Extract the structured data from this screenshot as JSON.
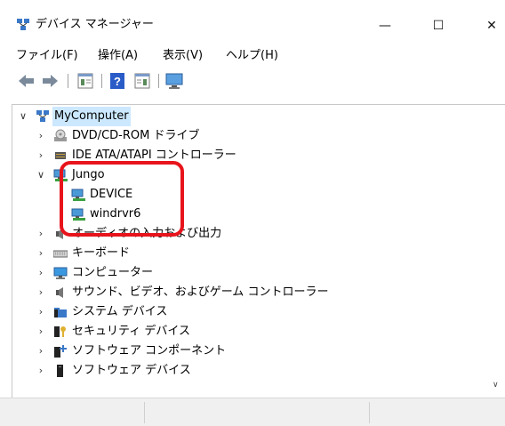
{
  "window": {
    "title": "デバイス マネージャー",
    "minimize_glyph": "—",
    "maximize_glyph": "☐",
    "close_glyph": "✕"
  },
  "menu": [
    {
      "label": "ファイル(F)"
    },
    {
      "label": "操作(A)"
    },
    {
      "label": "表示(V)"
    },
    {
      "label": "ヘルプ(H)"
    }
  ],
  "toolbar": {
    "icons": [
      "back-arrow-icon",
      "forward-arrow-icon",
      "properties-icon",
      "help-icon",
      "view-icon",
      "monitor-scan-icon"
    ]
  },
  "tree": {
    "root": {
      "label": "MyComputer",
      "expanded": true
    },
    "items": [
      {
        "label": "DVD/CD-ROM ドライブ",
        "icon": "dvd-drive-icon",
        "expanded": false
      },
      {
        "label": "IDE ATA/ATAPI コントローラー",
        "icon": "ide-controller-icon",
        "expanded": false
      },
      {
        "label": "Jungo",
        "icon": "network-device-icon",
        "expanded": true,
        "children": [
          {
            "label": "DEVICE",
            "icon": "network-device-icon"
          },
          {
            "label": "windrvr6",
            "icon": "network-device-icon"
          }
        ]
      },
      {
        "label": "オーディオの入力および出力",
        "icon": "speaker-icon",
        "expanded": false
      },
      {
        "label": "キーボード",
        "icon": "keyboard-icon",
        "expanded": false
      },
      {
        "label": "コンピューター",
        "icon": "monitor-icon",
        "expanded": false
      },
      {
        "label": "サウンド、ビデオ、およびゲーム コントローラー",
        "icon": "speaker-icon",
        "expanded": false
      },
      {
        "label": "システム デバイス",
        "icon": "folder-icon",
        "expanded": false
      },
      {
        "label": "セキュリティ デバイス",
        "icon": "security-key-icon",
        "expanded": false
      },
      {
        "label": "ソフトウェア コンポーネント",
        "icon": "software-component-icon",
        "expanded": false
      },
      {
        "label": "ソフトウェア デバイス",
        "icon": "software-device-icon",
        "expanded": false
      }
    ]
  },
  "colors": {
    "highlight_border": "#e8141c",
    "selection_bg": "#cce8ff",
    "status_bg": "#f0f0f0"
  }
}
